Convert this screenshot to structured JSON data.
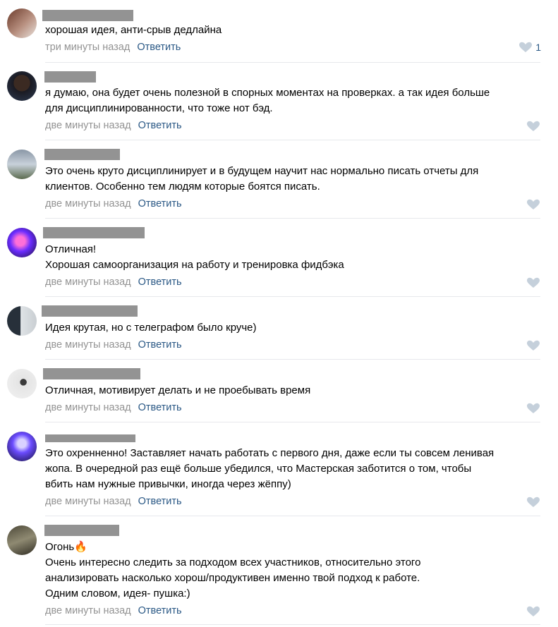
{
  "comments": [
    {
      "text": "хорошая идея, анти-срыв дедлайна",
      "time": "три минуты назад",
      "reply": "Ответить",
      "likes": "1"
    },
    {
      "text": "я думаю, она будет очень полезной в спорных моментах на проверках. а так идея больше\nдля дисциплинированности, что тоже нот бэд.",
      "time": "две минуты назад",
      "reply": "Ответить",
      "likes": ""
    },
    {
      "text": "Это очень круто дисциплинирует и в будущем научит нас нормально писать отчеты для\nклиентов. Особенно тем людям которые боятся писать.",
      "time": "две минуты назад",
      "reply": "Ответить",
      "likes": ""
    },
    {
      "text": "Отличная!\nХорошая самоорганизация на работу и тренировка фидбэка",
      "time": "две минуты назад",
      "reply": "Ответить",
      "likes": ""
    },
    {
      "text": "Идея крутая, но с телеграфом было круче)",
      "time": "две минуты назад",
      "reply": "Ответить",
      "likes": ""
    },
    {
      "text": "Отличная, мотивирует делать и не проебывать время",
      "time": "две минуты назад",
      "reply": "Ответить",
      "likes": ""
    },
    {
      "text": "Это охренненно! Заставляет начать работать с первого дня, даже если ты совсем ленивая\nжопа. В очередной раз ещё больше убедился, что Мастерская заботится о том, чтобы\nвбить нам нужные привычки, иногда через жёппу)",
      "time": "две минуты назад",
      "reply": "Ответить",
      "likes": ""
    },
    {
      "text": "Огонь🔥\nОчень интересно следить за подходом всех участников, относительно этого\nанализировать насколько хорош/продуктивен именно твой подход к работе.\nОдним словом, идея- пушка:)",
      "time": "две минуты назад",
      "reply": "Ответить",
      "likes": ""
    }
  ],
  "colors": {
    "name_redaction": "#939393",
    "link": "#2a5885",
    "meta": "#939393",
    "like_icon": "#c5d0db",
    "separator": "#e7e8ec"
  },
  "icons": {
    "like": "heart-icon"
  }
}
